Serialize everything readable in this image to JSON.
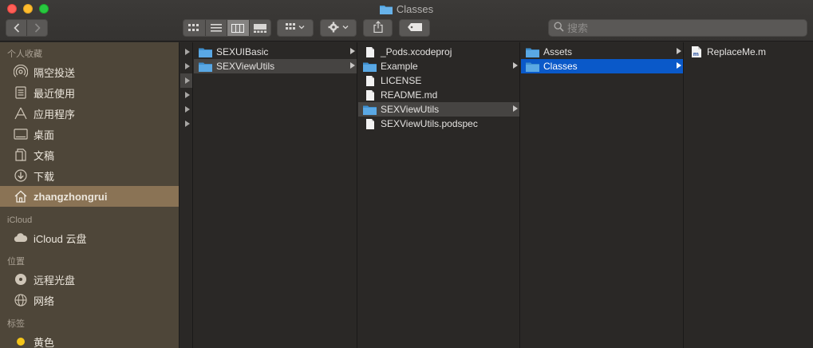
{
  "window": {
    "title": "Classes"
  },
  "toolbar": {
    "back_icon": "chevron-left-icon",
    "forward_icon": "chevron-right-icon",
    "views": [
      "icon-view-icon",
      "list-view-icon",
      "column-view-icon",
      "gallery-view-icon"
    ],
    "active_view": "column-view-icon",
    "search_placeholder": "搜索"
  },
  "sidebar": {
    "favorites_header": "个人收藏",
    "favorites": [
      {
        "label": "隔空投送",
        "icon": "airdrop-icon"
      },
      {
        "label": "最近使用",
        "icon": "recents-icon"
      },
      {
        "label": "应用程序",
        "icon": "applications-icon"
      },
      {
        "label": "桌面",
        "icon": "desktop-icon"
      },
      {
        "label": "文稿",
        "icon": "documents-icon"
      },
      {
        "label": "下载",
        "icon": "downloads-icon"
      },
      {
        "label": "zhangzhongrui",
        "icon": "home-icon",
        "selected": true
      }
    ],
    "icloud_header": "iCloud",
    "icloud": [
      {
        "label": "iCloud 云盘",
        "icon": "cloud-icon"
      }
    ],
    "locations_header": "位置",
    "locations": [
      {
        "label": "远程光盘",
        "icon": "disc-icon"
      },
      {
        "label": "网络",
        "icon": "network-icon"
      }
    ],
    "tags_header": "标签",
    "tags": [
      {
        "label": "黄色",
        "color": "#f5c518"
      }
    ]
  },
  "columns": {
    "col1": [
      {
        "name": "SEXUIBasic",
        "kind": "folder",
        "chevron": true
      },
      {
        "name": "SEXViewUtils",
        "kind": "folder",
        "chevron": true,
        "selection": "inactive"
      }
    ],
    "col2": [
      {
        "name": "_Pods.xcodeproj",
        "kind": "doc"
      },
      {
        "name": "Example",
        "kind": "folder",
        "chevron": true
      },
      {
        "name": "LICENSE",
        "kind": "doc"
      },
      {
        "name": "README.md",
        "kind": "doc"
      },
      {
        "name": "SEXViewUtils",
        "kind": "folder",
        "chevron": true,
        "selection": "inactive"
      },
      {
        "name": "SEXViewUtils.podspec",
        "kind": "doc"
      }
    ],
    "col3": [
      {
        "name": "Assets",
        "kind": "folder",
        "chevron": true
      },
      {
        "name": "Classes",
        "kind": "folder",
        "chevron": true,
        "selection": "active"
      }
    ],
    "col4": [
      {
        "name": "ReplaceMe.m",
        "kind": "m-file"
      }
    ]
  },
  "colors": {
    "accent": "#0a59c9",
    "folder": "#4fa3e0",
    "sidebar_selected": "#8a7355"
  }
}
